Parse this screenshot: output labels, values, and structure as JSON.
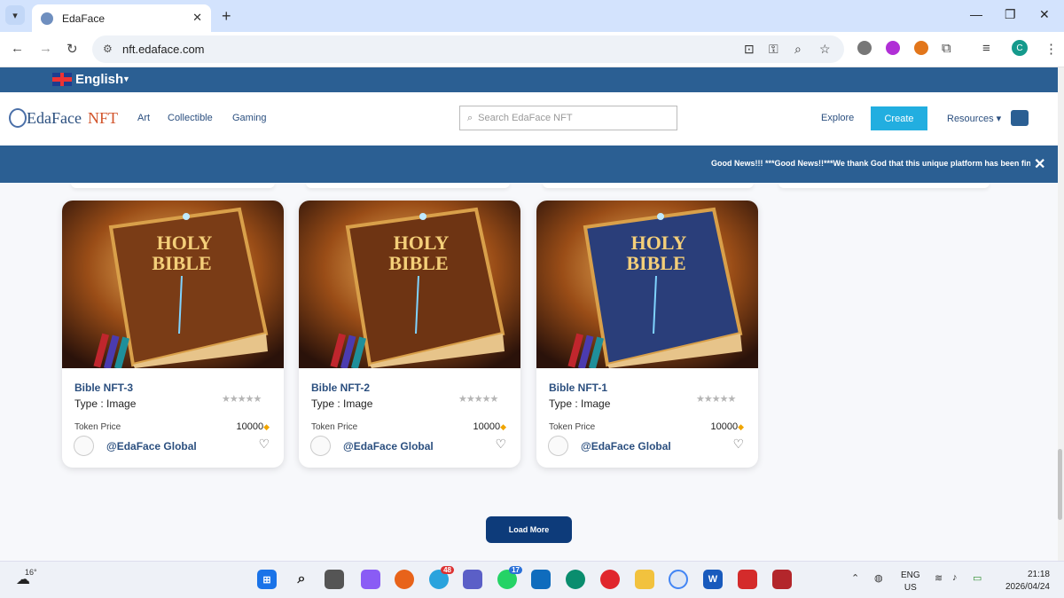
{
  "browser": {
    "tab_title": "EdaFace",
    "new_tab": "+",
    "url": "nft.edaface.com",
    "profile_initial": "C"
  },
  "site": {
    "language": "English",
    "brand": {
      "name": "EdaFace",
      "suffix": "NFT"
    },
    "nav": [
      "Art",
      "Collectible",
      "Gaming"
    ],
    "search_placeholder": "Search EdaFace NFT",
    "explore": "Explore",
    "create": "Create",
    "resources": "Resources",
    "ticker": "Good News!!! ***Good News!!***We thank God that this unique platform has been fina",
    "load_more": "Load More"
  },
  "cards": [
    {
      "title": "Bible NFT-3",
      "type": "Type : Image",
      "stars": "★★★★★",
      "price_label": "Token Price",
      "price": "10000",
      "owner": "@EdaFace Global",
      "book_color": "#7a3c16"
    },
    {
      "title": "Bible NFT-2",
      "type": "Type : Image",
      "stars": "★★★★★",
      "price_label": "Token Price",
      "price": "10000",
      "owner": "@EdaFace Global",
      "book_color": "#6e3413"
    },
    {
      "title": "Bible NFT-1",
      "type": "Type : Image",
      "stars": "★★★★★",
      "price_label": "Token Price",
      "price": "10000",
      "owner": "@EdaFace Global",
      "book_color": "#2a3e7a"
    }
  ],
  "image_text": {
    "line1": "HOLY",
    "line2": "BIBLE"
  },
  "taskbar": {
    "temp": "16°",
    "mail_badge": "48",
    "whatsapp_badge": "17",
    "lang": "ENG",
    "region": "US",
    "time": "21:18",
    "date": "2026/04/24"
  },
  "colors": {
    "primary": "#2b5f93",
    "accent": "#22aee0",
    "button_dark": "#0d3b7a",
    "brand_orange": "#d2552c"
  }
}
